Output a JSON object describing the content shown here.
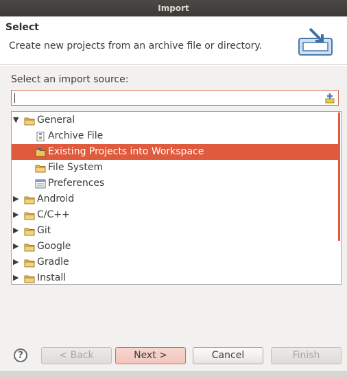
{
  "window": {
    "title": "Import"
  },
  "header": {
    "title": "Select",
    "description": "Create new projects from an archive file or directory."
  },
  "source": {
    "label": "Select an import source:",
    "filter_value": ""
  },
  "tree": [
    {
      "label": "General",
      "level": 0,
      "expanded": true,
      "icon": "folder-icon"
    },
    {
      "label": "Archive File",
      "level": 1,
      "icon": "archive-file-icon"
    },
    {
      "label": "Existing Projects into Workspace",
      "level": 1,
      "icon": "projects-into-workspace-icon",
      "selected": true
    },
    {
      "label": "File System",
      "level": 1,
      "icon": "folder-icon"
    },
    {
      "label": "Preferences",
      "level": 1,
      "icon": "preferences-icon"
    },
    {
      "label": "Android",
      "level": 0,
      "expanded": false,
      "icon": "folder-icon"
    },
    {
      "label": "C/C++",
      "level": 0,
      "expanded": false,
      "icon": "folder-icon"
    },
    {
      "label": "Git",
      "level": 0,
      "expanded": false,
      "icon": "folder-icon"
    },
    {
      "label": "Google",
      "level": 0,
      "expanded": false,
      "icon": "folder-icon"
    },
    {
      "label": "Gradle",
      "level": 0,
      "expanded": false,
      "icon": "folder-icon"
    },
    {
      "label": "Install",
      "level": 0,
      "expanded": false,
      "icon": "folder-icon"
    }
  ],
  "buttons": {
    "help": "?",
    "back": "< Back",
    "next": "Next >",
    "cancel": "Cancel",
    "finish": "Finish"
  },
  "colors": {
    "accent": "#e05a3e",
    "selection_text": "#ffffff"
  }
}
